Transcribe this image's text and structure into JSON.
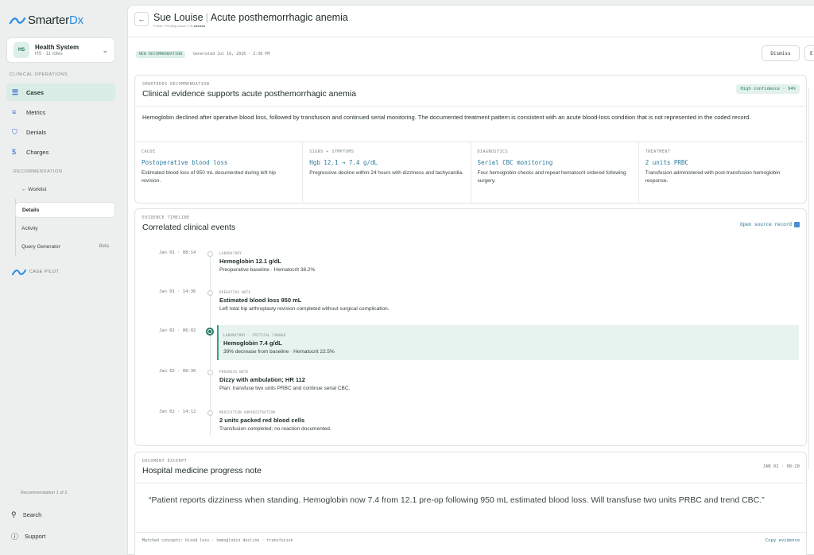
{
  "app": {
    "logo_main": "Smarter",
    "logo_accent": "Dx"
  },
  "org": {
    "badge": "HS",
    "name": "Health System",
    "sub": "HS · 11 roles"
  },
  "sidebar": {
    "section_clinical": "CLINICAL OPERATIONS",
    "items": [
      {
        "label": "Cases",
        "icon": "cases-icon"
      },
      {
        "label": "Metrics",
        "icon": "metrics-icon"
      },
      {
        "label": "Denials",
        "icon": "shield-icon"
      },
      {
        "label": "Charges",
        "icon": "dollar-icon"
      }
    ],
    "section_recommendation": "RECOMMENDATION",
    "sub_items": [
      {
        "label": "← Worklist"
      },
      {
        "label": "Details"
      },
      {
        "label": "Activity"
      },
      {
        "label": "Query Generator",
        "badge": "Beta"
      }
    ],
    "case_pilot": "CASE PILOT",
    "footer_count": "Recommendation 1 of 2",
    "search": "Search",
    "support": "Support"
  },
  "header": {
    "patient": "Sue Louise",
    "diagnosis": "Acute posthemorrhagic anemia",
    "breadcrumb": "Prebill / Pending cases / HS ■■■■■■"
  },
  "recbar": {
    "badge": "NEW RECOMMENDATION",
    "generated": "Generated Jul 16, 2026 · 2:38 PM",
    "dismiss": "Dismiss",
    "second_button": "E"
  },
  "recommendation": {
    "eyebrow": "SMARTERDX RECOMMENDATION",
    "title": "Clinical evidence supports acute posthemorrhagic anemia",
    "confidence": "High confidence · 94%",
    "summary": "Hemoglobin declined after operative blood loss, followed by transfusion and continued serial monitoring. The documented treatment pattern is consistent with an acute blood-loss condition that is not represented in the coded record.",
    "columns": [
      {
        "label": "CAUSE",
        "value": "Postoperative blood loss",
        "desc": "Estimated blood loss of 950 mL documented during left hip revision."
      },
      {
        "label": "SIGNS + SYMPTOMS",
        "value": "Hgb 12.1 → 7.4 g/dL",
        "desc": "Progressive decline within 24 hours with dizziness and tachycardia."
      },
      {
        "label": "DIAGNOSTICS",
        "value": "Serial CBC monitoring",
        "desc": "Four hemoglobin checks and repeat hematocrit ordered following surgery."
      },
      {
        "label": "TREATMENT",
        "value": "2 units PRBC",
        "desc": "Transfusion administered with post-transfusion hemoglobin response."
      }
    ]
  },
  "timeline": {
    "eyebrow": "EVIDENCE TIMELINE",
    "title": "Correlated clinical events",
    "open_link": "Open source record",
    "events": [
      {
        "time": "Jan 01 · 08:14",
        "type": "LABORATORY",
        "title": "Hemoglobin 12.1 g/dL",
        "desc": "Preoperative baseline · Hematocrit 36.2%"
      },
      {
        "time": "Jan 01 · 14:36",
        "type": "OPERATIVE NOTE",
        "title": "Estimated blood loss 950 mL",
        "desc": "Left total hip arthroplasty revision completed without surgical complication."
      },
      {
        "time": "Jan 02 · 06:02",
        "type": "LABORATORY · CRITICAL CHANGE",
        "title": "Hemoglobin 7.4 g/dL",
        "desc": "39% decrease from baseline · Hematocrit 22.5%"
      },
      {
        "time": "Jan 02 · 08:30",
        "type": "PROGRESS NOTE",
        "title": "Dizzy with ambulation; HR 112",
        "desc": "Plan: transfuse two units PRBC and continue serial CBC."
      },
      {
        "time": "Jan 02 · 14:12",
        "type": "MEDICATION ADMINISTRATION",
        "title": "2 units packed red blood cells",
        "desc": "Transfusion completed; no reaction documented."
      }
    ]
  },
  "document": {
    "eyebrow": "DOCUMENT EXCERPT",
    "title": "Hospital medicine progress note",
    "date": "JAN 02 · 08:20",
    "quote": "“Patient reports dizziness when standing. Hemoglobin now 7.4 from 12.1 pre-op following 950 mL estimated blood loss. Will transfuse two units PRBC and trend CBC.”",
    "concepts": "Matched concepts: blood loss · hemoglobin decline · transfusion",
    "copy": "Copy evidence"
  }
}
